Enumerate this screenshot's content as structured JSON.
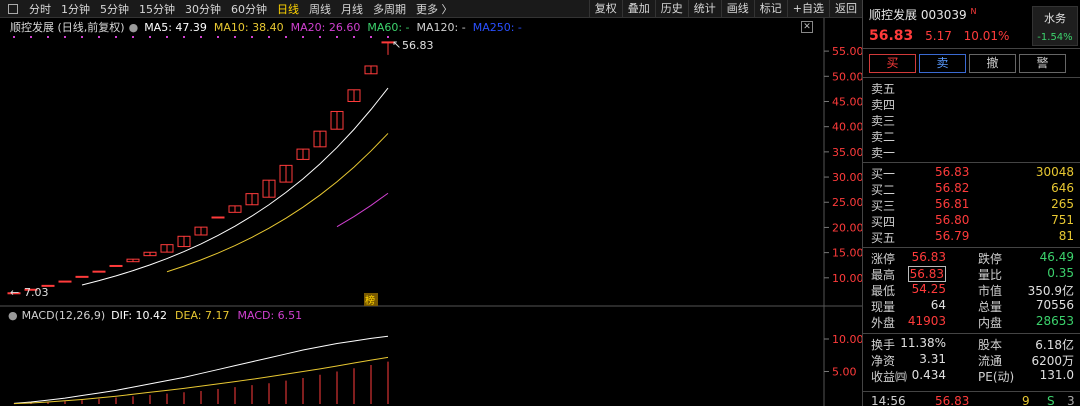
{
  "toolbar": {
    "periods": [
      "分时",
      "1分钟",
      "5分钟",
      "15分钟",
      "30分钟",
      "60分钟",
      "日线",
      "周线",
      "月线",
      "多周期",
      "更多 〉"
    ],
    "active_period": "日线",
    "buttons": [
      "复权",
      "叠加",
      "历史",
      "统计",
      "画线",
      "标记",
      "+自选",
      "返回"
    ]
  },
  "legend": {
    "title": "顺控发展 (日线,前复权)",
    "ma5": "MA5: 47.39",
    "ma10": "MA10: 38.40",
    "ma20": "MA20: 26.60",
    "ma60": "MA60: -",
    "ma120": "MA120: -",
    "ma250": "MA250: -"
  },
  "macd_legend": {
    "name": "MACD(12,26,9)",
    "dif": "DIF: 10.42",
    "dea": "DEA: 7.17",
    "macd": "MACD: 6.51"
  },
  "annotations": {
    "high": "56.83",
    "low": "7.03",
    "badge": "榜"
  },
  "colors": {
    "up": "#ff3b3b",
    "down": "#3cd26c",
    "ma5": "#ffffff",
    "ma10": "#e8c832",
    "ma20": "#d040d0",
    "ma60": "#3cd26c",
    "ma120": "#d0d0d0",
    "ma250": "#2a50ff",
    "volume": "#e8c832"
  },
  "price_axis": [
    "55.00",
    "50.00",
    "45.00",
    "40.00",
    "35.00",
    "30.00",
    "25.00",
    "20.00",
    "15.00",
    "10.00"
  ],
  "macd_axis": [
    "10.00",
    "5.00"
  ],
  "chart_data": {
    "type": "candlestick",
    "ylim": [
      5,
      58
    ],
    "candles": [
      {
        "o": 7.03,
        "h": 7.03,
        "l": 7.03,
        "c": 7.03
      },
      {
        "o": 7.73,
        "h": 7.73,
        "l": 7.73,
        "c": 7.73
      },
      {
        "o": 8.5,
        "h": 8.5,
        "l": 8.5,
        "c": 8.5
      },
      {
        "o": 9.35,
        "h": 9.35,
        "l": 9.35,
        "c": 9.35
      },
      {
        "o": 10.29,
        "h": 10.29,
        "l": 10.29,
        "c": 10.29
      },
      {
        "o": 11.32,
        "h": 11.32,
        "l": 11.32,
        "c": 11.32
      },
      {
        "o": 12.45,
        "h": 12.45,
        "l": 12.45,
        "c": 12.45
      },
      {
        "o": 13.2,
        "h": 13.7,
        "l": 13.2,
        "c": 13.7
      },
      {
        "o": 14.4,
        "h": 15.07,
        "l": 14.4,
        "c": 15.07
      },
      {
        "o": 15.1,
        "h": 16.58,
        "l": 15.1,
        "c": 16.58
      },
      {
        "o": 16.2,
        "h": 18.24,
        "l": 16.2,
        "c": 18.24
      },
      {
        "o": 18.5,
        "h": 20.06,
        "l": 18.5,
        "c": 20.06
      },
      {
        "o": 22.07,
        "h": 22.07,
        "l": 22.07,
        "c": 22.07
      },
      {
        "o": 23.0,
        "h": 24.28,
        "l": 23.0,
        "c": 24.28
      },
      {
        "o": 24.5,
        "h": 26.71,
        "l": 24.5,
        "c": 26.71
      },
      {
        "o": 26.0,
        "h": 29.38,
        "l": 26.0,
        "c": 29.38
      },
      {
        "o": 29.0,
        "h": 32.32,
        "l": 29.0,
        "c": 32.32
      },
      {
        "o": 33.5,
        "h": 35.55,
        "l": 33.5,
        "c": 35.55
      },
      {
        "o": 36.0,
        "h": 39.11,
        "l": 36.0,
        "c": 39.11
      },
      {
        "o": 39.5,
        "h": 43.02,
        "l": 39.5,
        "c": 43.02
      },
      {
        "o": 45.0,
        "h": 47.32,
        "l": 45.0,
        "c": 47.32
      },
      {
        "o": 50.5,
        "h": 52.05,
        "l": 50.5,
        "c": 52.05
      },
      {
        "o": 56.83,
        "h": 56.83,
        "l": 54.25,
        "c": 56.83
      }
    ],
    "macd_hist": [
      0.05,
      0.15,
      0.3,
      0.45,
      0.6,
      0.8,
      1.0,
      1.2,
      1.4,
      1.6,
      1.8,
      2.0,
      2.3,
      2.6,
      2.9,
      3.2,
      3.6,
      4.0,
      4.5,
      5.0,
      5.5,
      6.0,
      6.51
    ],
    "dif": [
      0.1,
      0.3,
      0.6,
      0.9,
      1.3,
      1.7,
      2.1,
      2.6,
      3.1,
      3.6,
      4.1,
      4.7,
      5.3,
      5.9,
      6.5,
      7.1,
      7.7,
      8.3,
      8.8,
      9.3,
      9.7,
      10.1,
      10.42
    ],
    "dea": [
      0.05,
      0.15,
      0.3,
      0.5,
      0.7,
      0.95,
      1.2,
      1.5,
      1.8,
      2.1,
      2.4,
      2.75,
      3.1,
      3.45,
      3.8,
      4.2,
      4.6,
      5.0,
      5.4,
      5.85,
      6.3,
      6.75,
      7.17
    ],
    "macd_ylim": [
      0,
      12
    ]
  },
  "quote": {
    "name": "顺控发展",
    "code": "003039",
    "n_badge": "N",
    "price": "56.83",
    "change": "5.17",
    "pct": "10.01%",
    "water_label": "水务",
    "water_pct": "-1.54%"
  },
  "actions": [
    "买",
    "卖",
    "撤",
    "警"
  ],
  "sell_levels": [
    "卖五",
    "卖四",
    "卖三",
    "卖二",
    "卖一"
  ],
  "buy_levels": [
    {
      "label": "买一",
      "price": "56.83",
      "vol": "30048"
    },
    {
      "label": "买二",
      "price": "56.82",
      "vol": "646"
    },
    {
      "label": "买三",
      "price": "56.81",
      "vol": "265"
    },
    {
      "label": "买四",
      "price": "56.80",
      "vol": "751"
    },
    {
      "label": "买五",
      "price": "56.79",
      "vol": "81"
    }
  ],
  "stats": {
    "zt_l": "涨停",
    "zt_v": "56.83",
    "dt_l": "跌停",
    "dt_v": "46.49",
    "zg_l": "最高",
    "zg_v": "56.83",
    "lb_l": "量比",
    "lb_v": "0.35",
    "zd_l": "最低",
    "zd_v": "54.25",
    "sz_l": "市值",
    "sz_v": "350.9亿",
    "xl_l": "现量",
    "xl_v": "64",
    "zl_l": "总量",
    "zl_v": "70556",
    "wp_l": "外盘",
    "wp_v": "41903",
    "np_l": "内盘",
    "np_v": "28653",
    "hs_l": "换手",
    "hs_v": "11.38%",
    "gb_l": "股本",
    "gb_v": "6.18亿",
    "jz_l": "净资",
    "jz_v": "3.31",
    "lt_l": "流通",
    "lt_v": "6200万",
    "sy_l": "收益㈣",
    "sy_v": "0.434",
    "pe_l": "PE(动)",
    "pe_v": "131.0"
  },
  "tick": {
    "time": "14:56",
    "price": "56.83",
    "vol": "9",
    "side": "S",
    "num": "3"
  }
}
